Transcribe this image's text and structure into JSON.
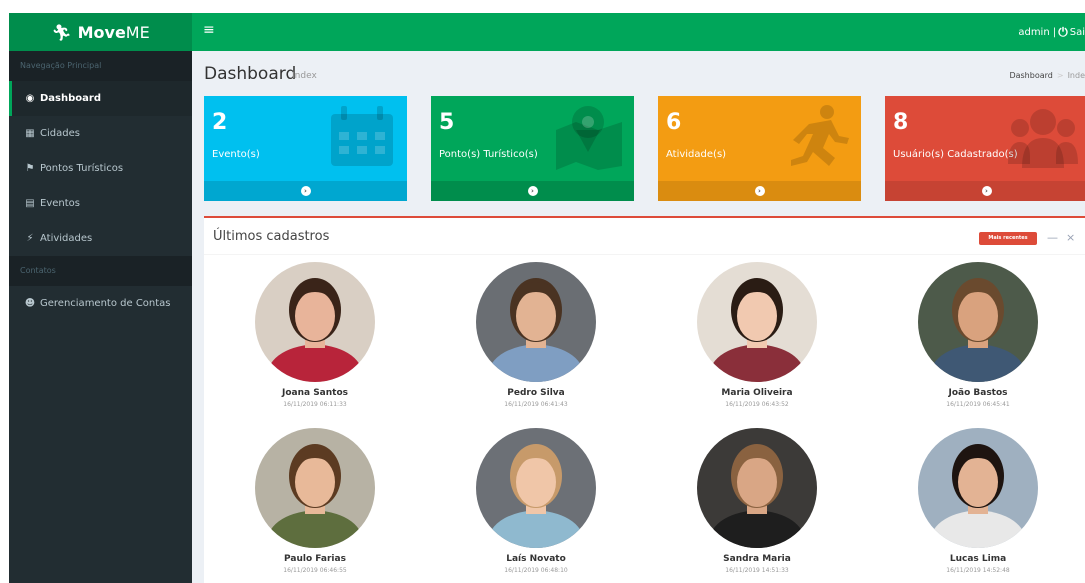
{
  "brand": {
    "icon": "running-person-icon",
    "name_bold": "Move",
    "name_rest": "ME",
    "color": "#00a65a"
  },
  "topbar": {
    "menu_icon": "≡",
    "user": "admin |",
    "power_icon": "⏻",
    "logout": "Sai"
  },
  "sidebar": {
    "section_main": "Navegação Principal",
    "items": [
      {
        "icon": "dashboard-icon",
        "glyph": "◉",
        "label": "Dashboard"
      },
      {
        "icon": "city-icon",
        "glyph": "▦",
        "label": "Cidades"
      },
      {
        "icon": "map-pin-icon",
        "glyph": "⚑",
        "label": "Pontos Turísticos"
      },
      {
        "icon": "calendar-icon",
        "glyph": "▤",
        "label": "Eventos"
      },
      {
        "icon": "running-icon",
        "glyph": "⚡",
        "label": "Atividades"
      }
    ],
    "section_accounts": "Contatos",
    "account_item": {
      "icon": "users-icon",
      "glyph": "☻",
      "label": "Gerenciamento de Contas"
    }
  },
  "page": {
    "title": "Dashboard",
    "subtitle": "Index",
    "breadcrumb_home": "Dashboard",
    "breadcrumb_current": "Inde"
  },
  "stats": [
    {
      "value": "2",
      "label": "Evento(s)",
      "color": "#00c0ef",
      "footer_color": "#00a7d0",
      "icon": "calendar-icon"
    },
    {
      "value": "5",
      "label": "Ponto(s) Turístico(s)",
      "color": "#00a65a",
      "footer_color": "#008d4c",
      "icon": "map-icon"
    },
    {
      "value": "6",
      "label": "Atividade(s)",
      "color": "#f39c12",
      "footer_color": "#da8c10",
      "icon": "running-icon"
    },
    {
      "value": "8",
      "label": "Usuário(s) Cadastrado(s)",
      "color": "#dd4b39",
      "footer_color": "#c64333",
      "icon": "users-icon"
    }
  ],
  "recent": {
    "title": "Últimos cadastros",
    "badge": "Mais recentes",
    "collapse": "—",
    "close": "×",
    "people": [
      {
        "name": "Joana Santos",
        "date": "16/11/2019 06:11:33",
        "bg": "#d9cfc4",
        "skin": "#e8b49a",
        "hair": "#3a2419",
        "shirt": "#b8243a"
      },
      {
        "name": "Pedro Silva",
        "date": "16/11/2019 06:41:43",
        "bg": "#6a6e73",
        "skin": "#e2b393",
        "hair": "#4a3322",
        "shirt": "#7f9ec2"
      },
      {
        "name": "Maria Oliveira",
        "date": "16/11/2019 06:43:52",
        "bg": "#e4ddd4",
        "skin": "#f1c9b0",
        "hair": "#2a1c14",
        "shirt": "#8a2f3a"
      },
      {
        "name": "João Bastos",
        "date": "16/11/2019 06:45:41",
        "bg": "#4d5a4a",
        "skin": "#d9a27e",
        "hair": "#6a4a2e",
        "shirt": "#3f5874"
      },
      {
        "name": "Paulo Farias",
        "date": "16/11/2019 06:46:55",
        "bg": "#b7b2a4",
        "skin": "#e8b999",
        "hair": "#5c3b22",
        "shirt": "#5e6e3e"
      },
      {
        "name": "Laís Novato",
        "date": "16/11/2019 06:48:10",
        "bg": "#6c7076",
        "skin": "#f0c6a8",
        "hair": "#c79a6a",
        "shirt": "#8fb9cf"
      },
      {
        "name": "Sandra Maria",
        "date": "16/11/2019 14:51:33",
        "bg": "#3c3a38",
        "skin": "#d9a685",
        "hair": "#8a6240",
        "shirt": "#1e1e1e"
      },
      {
        "name": "Lucas Lima",
        "date": "16/11/2019 14:52:48",
        "bg": "#9fb0c0",
        "skin": "#e3b394",
        "hair": "#1e1410",
        "shirt": "#e8e8e8"
      }
    ]
  }
}
